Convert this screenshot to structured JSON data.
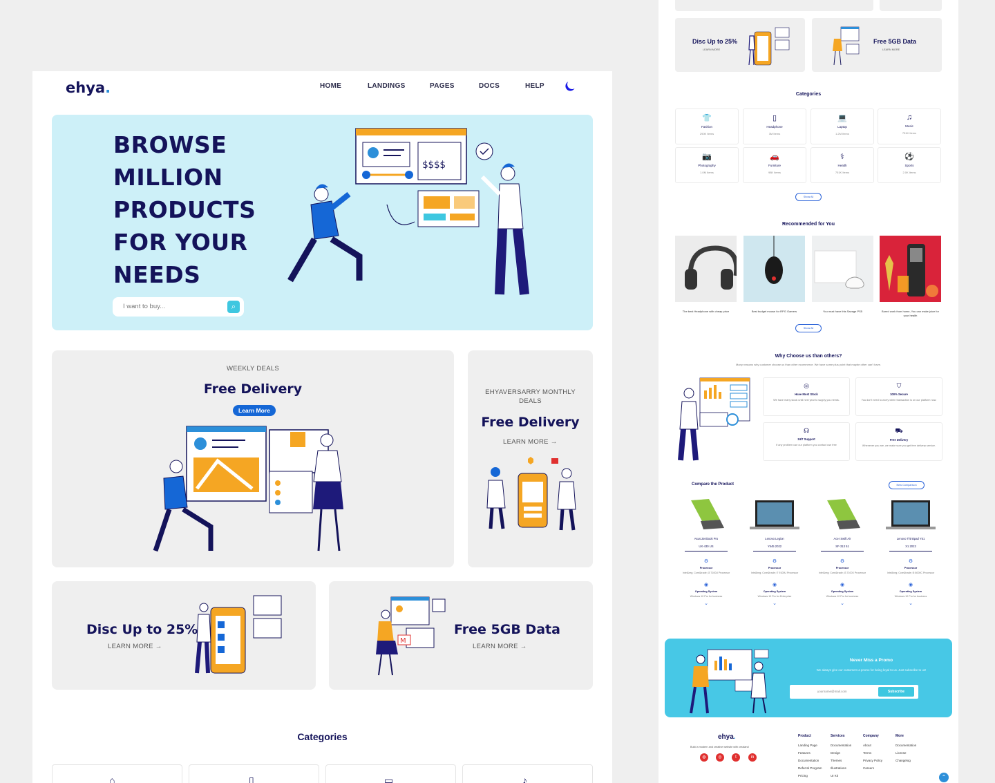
{
  "nav": {
    "logo": "ehya",
    "logo_dot": ".",
    "links": [
      "HOME",
      "LANDINGS",
      "PAGES",
      "DOCS",
      "HELP"
    ]
  },
  "hero": {
    "title": "BROWSE MILLION PRODUCTS FOR YOUR NEEDS",
    "search_placeholder": "I want to buy..."
  },
  "deals": [
    {
      "eyebrow": "WEEKLY DEALS",
      "title": "Free Delivery",
      "cta": "Learn More"
    },
    {
      "eyebrow": "EHYAVERSARRY MONTHLY DEALS",
      "title": "Free Delivery",
      "cta": "LEARN MORE"
    },
    {
      "title": "Disc Up to 25%",
      "cta": "LEARN MORE"
    },
    {
      "title": "Free 5GB Data",
      "cta": "LEARN MORE"
    }
  ],
  "categories_title": "Categories",
  "right": {
    "promo_cards": [
      {
        "title": "Disc Up to 25%",
        "cta": "LEARN MORE"
      },
      {
        "title": "Free 5GB Data",
        "cta": "LEARN MORE"
      }
    ],
    "categories_title": "Categories",
    "categories": [
      {
        "icon": "shirt-icon",
        "glyph": "👕",
        "name": "Fashion",
        "count": "290K Items"
      },
      {
        "icon": "phone-icon",
        "glyph": "▯",
        "name": "Headphone",
        "count": "3M Items"
      },
      {
        "icon": "laptop-icon",
        "glyph": "💻",
        "name": "Laptop",
        "count": "1.2M Items"
      },
      {
        "icon": "music-icon",
        "glyph": "♫",
        "name": "Music",
        "count": "751K Items"
      },
      {
        "icon": "camera-icon",
        "glyph": "📷",
        "name": "Photography",
        "count": "1.0M Items"
      },
      {
        "icon": "car-icon",
        "glyph": "🚗",
        "name": "Furniture",
        "count": "98K Items"
      },
      {
        "icon": "stethoscope-icon",
        "glyph": "⚕",
        "name": "Health",
        "count": "751K Items"
      },
      {
        "icon": "ball-icon",
        "glyph": "⚽",
        "name": "Sports",
        "count": "2.0K Items"
      }
    ],
    "show_all": "Show All",
    "recommended_title": "Recommended for You",
    "products": [
      {
        "caption": "The best Headphone with cheap price",
        "bg": "#ececec"
      },
      {
        "caption": "Best budget mouse for RPG Gamers",
        "bg": "#cfe7ef"
      },
      {
        "caption": "You must have this Savage PS5",
        "bg": "#eef0f1"
      },
      {
        "caption": "Bored work from home, You can make juice for your health",
        "bg": "#d9233a"
      }
    ],
    "show_all_2": "Show All",
    "why_title": "Why Choose us than others?",
    "why_sub": "Many reasons why customer choose us than other ecommerce. We have some plus point that maybe other can't have.",
    "features": [
      {
        "icon": "box-icon",
        "glyph": "◎",
        "title": "Have Most Stock",
        "desc": "We have many stock until next year to supply you needs."
      },
      {
        "icon": "shield-icon",
        "glyph": "⛉",
        "title": "100% Secure",
        "desc": "You don't need to worry when transaction is on our platform now."
      },
      {
        "icon": "support-icon",
        "glyph": "☊",
        "title": "24/7 Support",
        "desc": "If any problem use our platform you contact use free"
      },
      {
        "icon": "truck-icon",
        "glyph": "⛟",
        "title": "Free Delivery",
        "desc": "Whenever you are, we make sure you get free delivery service."
      }
    ],
    "compare_title": "Compare the Product",
    "new_comparison": "New Comparison",
    "compare": [
      {
        "name": "Asus Zenbook Pro",
        "model": "UX-430 US",
        "proc": "Intel&reg; Core&trade; i3 7100U Processor",
        "os": "Windows 10 Pro for business",
        "color": "green"
      },
      {
        "name": "Lenovo Legion",
        "model": "Y545 2022",
        "proc": "Intel&reg; Core&trade; i7 9100U Processor",
        "os": "Windows 10 Pro for Enterprise",
        "color": "dark"
      },
      {
        "name": "Acer Swift Air",
        "model": "SF-313 51",
        "proc": "Intel&reg; Core&trade; i3 7100X Processor",
        "os": "Windows 10 Pro for business",
        "color": "green"
      },
      {
        "name": "Lenovo Thinkpad Y51",
        "model": "X1 2022",
        "proc": "Intel&reg; Core&trade; i5 8000C Processor",
        "os": "Windows 10 Pro for business",
        "color": "dark"
      }
    ],
    "processor_label": "Processor",
    "os_label": "Operating System",
    "promo": {
      "title": "Never Miss a Promo",
      "desc": "We always give our customers a promo for being loyal to us. Just subscribe to us!",
      "email_placeholder": "yourname@mail.com",
      "subscribe": "Subscribe"
    },
    "footer": {
      "logo": "ehya",
      "tagline": "Build a modern and creative website with crealand",
      "columns": [
        {
          "title": "Product",
          "items": [
            "Landing Page",
            "Features",
            "Documentation",
            "Referral Program",
            "Pricing"
          ]
        },
        {
          "title": "Services",
          "items": [
            "Documentation",
            "Design",
            "Themes",
            "Illustrations",
            "UI Kit"
          ]
        },
        {
          "title": "Company",
          "items": [
            "About",
            "Terms",
            "Privacy Policy",
            "Careers"
          ]
        },
        {
          "title": "More",
          "items": [
            "Documentation",
            "License",
            "Changelog"
          ]
        }
      ]
    }
  },
  "colors": {
    "navy": "#14135a",
    "sky": "#cdf0f8",
    "accent": "#1567d6",
    "promo": "#47c8e6",
    "orange": "#f5a623"
  }
}
